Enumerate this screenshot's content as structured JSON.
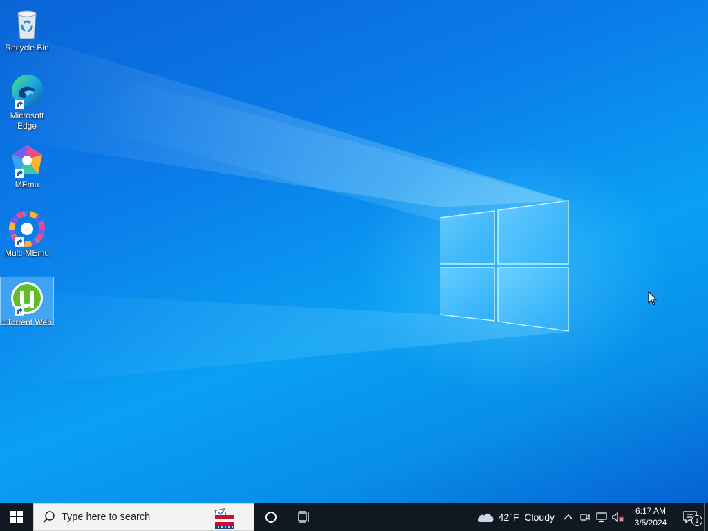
{
  "desktop": {
    "icons": [
      {
        "label": "Recycle Bin",
        "icon": "recycle-bin-icon",
        "shortcut": false,
        "selected": false
      },
      {
        "label": "Microsoft Edge",
        "icon": "edge-icon",
        "shortcut": true,
        "selected": false
      },
      {
        "label": "MEmu",
        "icon": "memu-icon",
        "shortcut": true,
        "selected": false
      },
      {
        "label": "Multi-MEmu",
        "icon": "multi-memu-icon",
        "shortcut": true,
        "selected": false
      },
      {
        "label": "uTorrent Web",
        "icon": "utorrent-icon",
        "shortcut": true,
        "selected": true
      }
    ],
    "cursor": "busy-pointer"
  },
  "taskbar": {
    "start_icon": "windows-logo-icon",
    "search": {
      "placeholder": "Type here to search",
      "icon": "search-icon",
      "highlight_icon": "ballot-box-icon"
    },
    "cortana_icon": "cortana-circle-icon",
    "task_view_icon": "task-view-icon",
    "weather": {
      "icon": "cloudy-icon",
      "temperature": "42°F",
      "condition": "Cloudy"
    },
    "tray_icons": [
      "chevron-up-icon",
      "meet-now-icon",
      "network-icon",
      "volume-muted-icon"
    ],
    "clock": {
      "time": "6:17 AM",
      "date": "3/5/2024"
    },
    "notifications": {
      "icon": "action-center-icon",
      "count": "1"
    }
  },
  "colors": {
    "taskbar": "#101821",
    "search_bg": "#f3f3f3",
    "wallpaper_accent": "#0aa0f4"
  }
}
